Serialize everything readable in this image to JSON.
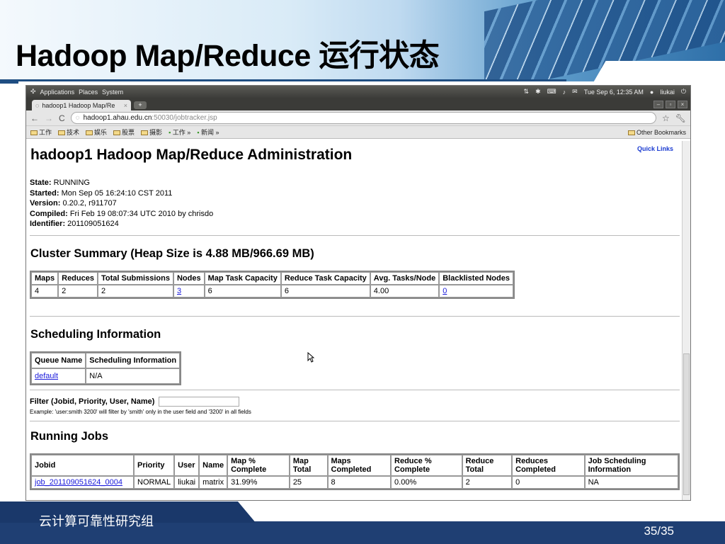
{
  "slide": {
    "title": "Hadoop Map/Reduce 运行状态",
    "footer_text": "云计算可靠性研究组",
    "page_number": "35/35"
  },
  "os_bar": {
    "menus": [
      "Applications",
      "Places",
      "System"
    ],
    "clock": "Tue Sep 6, 12:35 AM",
    "user": "liukai"
  },
  "browser": {
    "tab_title": "hadoop1 Hadoop Map/Re",
    "url_host": "hadoop1.ahau.edu.cn",
    "url_rest": ":50030/jobtracker.jsp",
    "bookmarks": [
      "工作",
      "技术",
      "娱乐",
      "股票",
      "摄影",
      "工作 »",
      "新闻 »"
    ],
    "other_bookmarks": "Other Bookmarks"
  },
  "page": {
    "quick_links": "Quick Links",
    "heading": "hadoop1 Hadoop Map/Reduce Administration",
    "info": [
      {
        "label": "State:",
        "value": " RUNNING"
      },
      {
        "label": "Started:",
        "value": " Mon Sep 05 16:24:10 CST 2011"
      },
      {
        "label": "Version:",
        "value": " 0.20.2, r911707"
      },
      {
        "label": "Compiled:",
        "value": " Fri Feb 19 08:07:34 UTC 2010 by chrisdo"
      },
      {
        "label": "Identifier:",
        "value": " 201109051624"
      }
    ],
    "cluster_heading": "Cluster Summary (Heap Size is 4.88 MB/966.69 MB)",
    "cluster": {
      "headers": [
        "Maps",
        "Reduces",
        "Total Submissions",
        "Nodes",
        "Map Task Capacity",
        "Reduce Task Capacity",
        "Avg. Tasks/Node",
        "Blacklisted Nodes"
      ],
      "values": [
        "4",
        "2",
        "2",
        "3",
        "6",
        "6",
        "4.00",
        "0"
      ]
    },
    "scheduling_heading": "Scheduling Information",
    "scheduling": {
      "headers": [
        "Queue Name",
        "Scheduling Information"
      ],
      "values": [
        "default",
        "N/A"
      ]
    },
    "filter_label": "Filter (Jobid, Priority, User, Name)",
    "filter_example": "Example: 'user:smith 3200' will filter by 'smith' only in the user field and '3200' in all fields",
    "running_heading": "Running Jobs",
    "running": {
      "headers": [
        "Jobid",
        "Priority",
        "User",
        "Name",
        "Map % Complete",
        "Map Total",
        "Maps Completed",
        "Reduce % Complete",
        "Reduce Total",
        "Reduces Completed",
        "Job Scheduling Information"
      ],
      "row": [
        "job_201109051624_0004",
        "NORMAL",
        "liukai",
        "matrix",
        "31.99%",
        "25",
        "8",
        "0.00%",
        "2",
        "0",
        "NA"
      ]
    }
  }
}
